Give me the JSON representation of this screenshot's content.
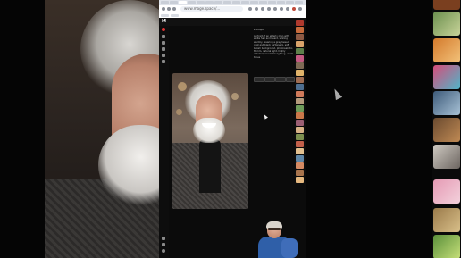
{
  "browser": {
    "url": "www.mage.space/...",
    "tab_count": 16
  },
  "app": {
    "logo": "M",
    "prompt_title": "Prompt",
    "prompt_text": "portrait of an elderly man with white hair and beard, smiling warmly, wearing a grey tweed coat and black turtleneck, soft bokeh background, photorealistic, 85mm, natural light, highly detailed, cinematic lighting, warm tones",
    "buttons": [
      "Copy",
      "Remix",
      "Edit",
      "Share"
    ]
  },
  "colors": {
    "rail_accent": "#dd3333",
    "webcam_shirt": "#2f5fa8"
  }
}
